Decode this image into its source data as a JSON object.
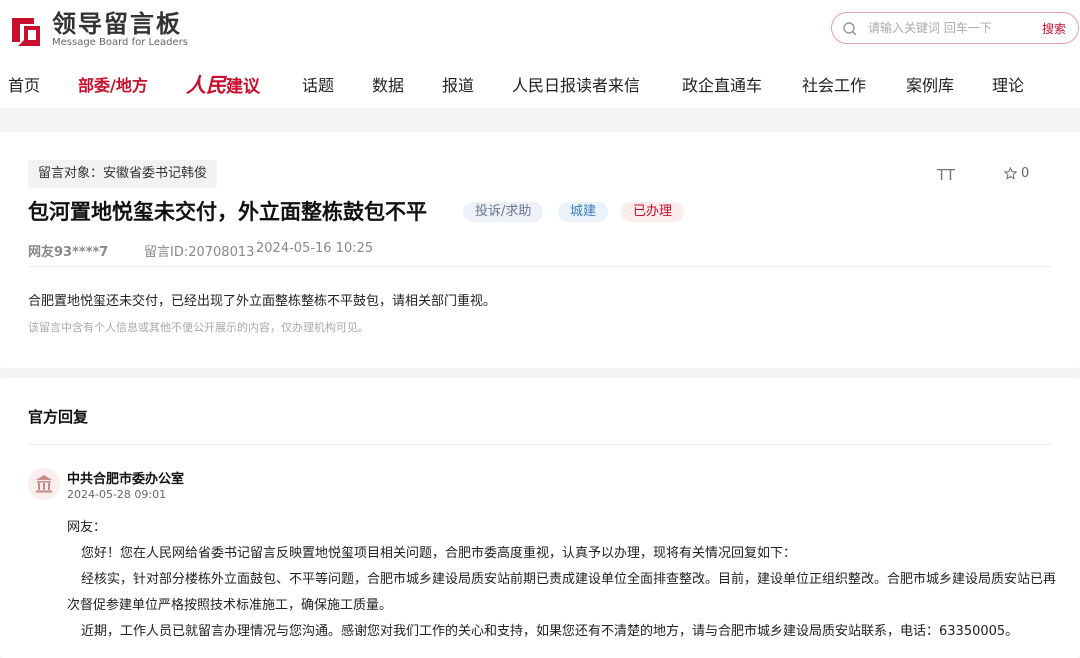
{
  "header": {
    "logo_title": "领导留言板",
    "logo_subtitle": "Message Board for Leaders",
    "search_placeholder": "请输入关键词 回车一下",
    "search_button": "搜索"
  },
  "nav": {
    "items": [
      {
        "label": "首页"
      },
      {
        "label": "部委/地方"
      },
      {
        "label_script": "人民",
        "label": "建议"
      },
      {
        "label": "话题"
      },
      {
        "label": "数据"
      },
      {
        "label": "报道"
      },
      {
        "label": "人民日报读者来信"
      },
      {
        "label": "政企直通车"
      },
      {
        "label": "社会工作"
      },
      {
        "label": "案例库"
      },
      {
        "label": "理论"
      }
    ],
    "active_index": 1
  },
  "message": {
    "target": "留言对象：安徽省委书记韩俊",
    "font_toggle": "TT",
    "favorites_count": "0",
    "title": "包河置地悦玺未交付，外立面整栋鼓包不平",
    "tags": {
      "type": "投诉/求助",
      "field": "城建",
      "status": "已办理"
    },
    "user": "网友93****7",
    "message_id": "留言ID:20708013",
    "time": "2024-05-16 10:25",
    "content": "合肥置地悦玺还未交付，已经出现了外立面整栋整栋不平鼓包，请相关部门重视。",
    "privacy_note": "该留言中含有个人信息或其他不便公开展示的内容，仅办理机构可见。"
  },
  "reply": {
    "heading": "官方回复",
    "org": "中共合肥市委办公室",
    "time": "2024-05-28 09:01",
    "salutation": "网友：",
    "p1": "您好！您在人民网给省委书记留言反映置地悦玺项目相关问题，合肥市委高度重视，认真予以办理，现将有关情况回复如下：",
    "p2a": "经核实，针对部分楼栋外立面鼓包、不平等问题，合肥市城乡建设局质安站前期已责成建设单位全面排查整改。目前，建设单位正组织整改。合肥市城乡建设局质安站已再",
    "p2b": "次督促参建单位严格按照技术标准施工，确保施工质量。",
    "p3": "近期，工作人员已就留言办理情况与您沟通。感谢您对我们工作的关心和支持，如果您还有不清楚的地方，请与合肥市城乡建设局质安站联系，电话：63350005。"
  },
  "colors": {
    "brand_red": "#c8102e",
    "page_bg": "#f5f5f5"
  }
}
